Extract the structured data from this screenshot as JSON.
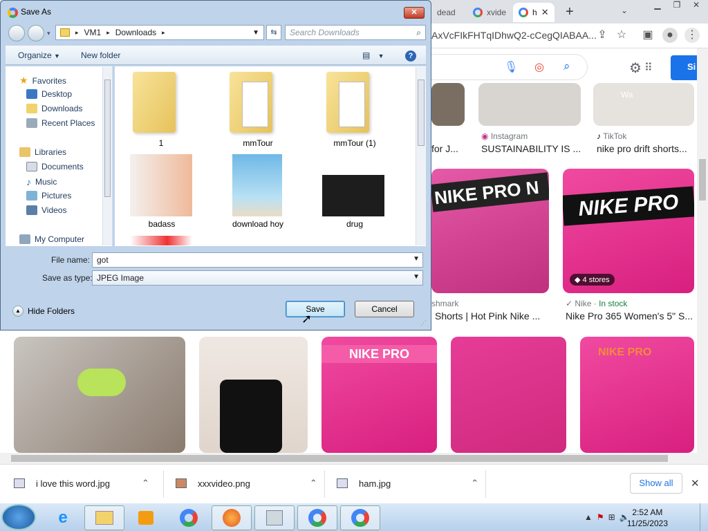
{
  "browser": {
    "tabs": [
      {
        "label": "dead"
      },
      {
        "label": "xvide"
      },
      {
        "label": "h"
      }
    ],
    "url": "AxVcFIkFHTqIDhwQ2-cCegQIABAA...",
    "sign_in": "Si"
  },
  "results": {
    "row1": [
      {
        "source": "",
        "title": "for J..."
      },
      {
        "source": "Instagram",
        "title": "SUSTAINABILITY IS ..."
      },
      {
        "source": "TikTok",
        "title": "nike pro drift shorts..."
      }
    ],
    "row2": [
      {
        "source": "shmark",
        "title": "Shorts | Hot Pink Nike ..."
      },
      {
        "source": "Nike · ",
        "stock": "In stock",
        "title": "Nike Pro 365 Women's 5\" S...",
        "badge": "4 stores"
      }
    ],
    "thumb_texts": {
      "nike_pro_1": "NIKE PRO N",
      "nike_pro_2": "NIKE PRO",
      "nike_pro_3": "NIKE PRO",
      "nike_pro_4": "NIKE PRO",
      "tiktok_overlay": "Wa"
    }
  },
  "downloads": {
    "items": [
      {
        "name": "i love this word.jpg"
      },
      {
        "name": "xxxvideo.png"
      },
      {
        "name": "ham.jpg"
      }
    ],
    "show_all": "Show all"
  },
  "taskbar": {
    "time": "2:52 AM",
    "date": "11/25/2023"
  },
  "dialog": {
    "title": "Save As",
    "breadcrumb": [
      "VM1",
      "Downloads"
    ],
    "search_placeholder": "Search Downloads",
    "organize": "Organize",
    "new_folder": "New folder",
    "nav": {
      "favorites": "Favorites",
      "desktop": "Desktop",
      "downloads": "Downloads",
      "recent": "Recent Places",
      "libraries": "Libraries",
      "documents": "Documents",
      "music": "Music",
      "pictures": "Pictures",
      "videos": "Videos",
      "computer": "My Computer"
    },
    "files": [
      {
        "name": "1"
      },
      {
        "name": "mmTour"
      },
      {
        "name": "mmTour (1)"
      },
      {
        "name": "badass"
      },
      {
        "name": "download hoy"
      },
      {
        "name": "drug"
      }
    ],
    "file_name_label": "File name:",
    "file_name_value": "got",
    "save_type_label": "Save as type:",
    "save_type_value": "JPEG Image",
    "hide_folders": "Hide Folders",
    "save": "Save",
    "cancel": "Cancel"
  },
  "colors": {
    "accent": "#1a73e8",
    "pink": "#e8308f",
    "stock_green": "#188038"
  }
}
